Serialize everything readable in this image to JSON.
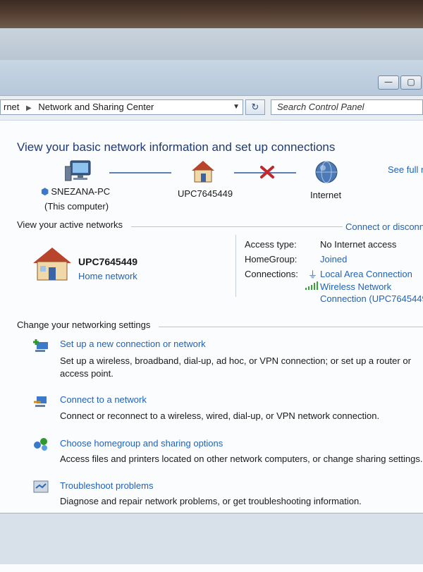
{
  "address_bar": {
    "crumb_prefix": "rnet",
    "crumb_current": "Network and Sharing Center",
    "search_placeholder": "Search Control Panel"
  },
  "window_buttons": {
    "minimize": "—",
    "maximize": "▢"
  },
  "page": {
    "heading": "View your basic network information and set up connections",
    "see_full_map": "See full r"
  },
  "network_map": {
    "computer_name": "SNEZANA-PC",
    "computer_sub": "(This computer)",
    "router_name": "UPC7645449",
    "internet_label": "Internet"
  },
  "active_networks": {
    "section_title": "View your active networks",
    "connect_link": "Connect or disconn",
    "network_name": "UPC7645449",
    "network_type": "Home network",
    "access_type_label": "Access type:",
    "access_type_value": "No Internet access",
    "homegroup_label": "HomeGroup:",
    "homegroup_value": "Joined",
    "connections_label": "Connections:",
    "connection_lan": "Local Area Connection",
    "connection_wifi_line1": "Wireless Network",
    "connection_wifi_line2": "Connection (UPC7645449"
  },
  "settings": {
    "section_title": "Change your networking settings",
    "items": [
      {
        "title": "Set up a new connection or network",
        "desc1": "Set up a wireless, broadband, dial-up, ad hoc, or VPN connection; or set up a router or",
        "desc2": "access point."
      },
      {
        "title": "Connect to a network",
        "desc1": "Connect or reconnect to a wireless, wired, dial-up, or VPN network connection."
      },
      {
        "title": "Choose homegroup and sharing options",
        "desc1": "Access files and printers located on other network computers, or change sharing settings."
      },
      {
        "title": "Troubleshoot problems",
        "desc1": "Diagnose and repair network problems, or get troubleshooting information."
      }
    ]
  },
  "colors": {
    "link": "#1f62b8",
    "heading": "#1e3a74",
    "error_x": "#c0282d"
  }
}
